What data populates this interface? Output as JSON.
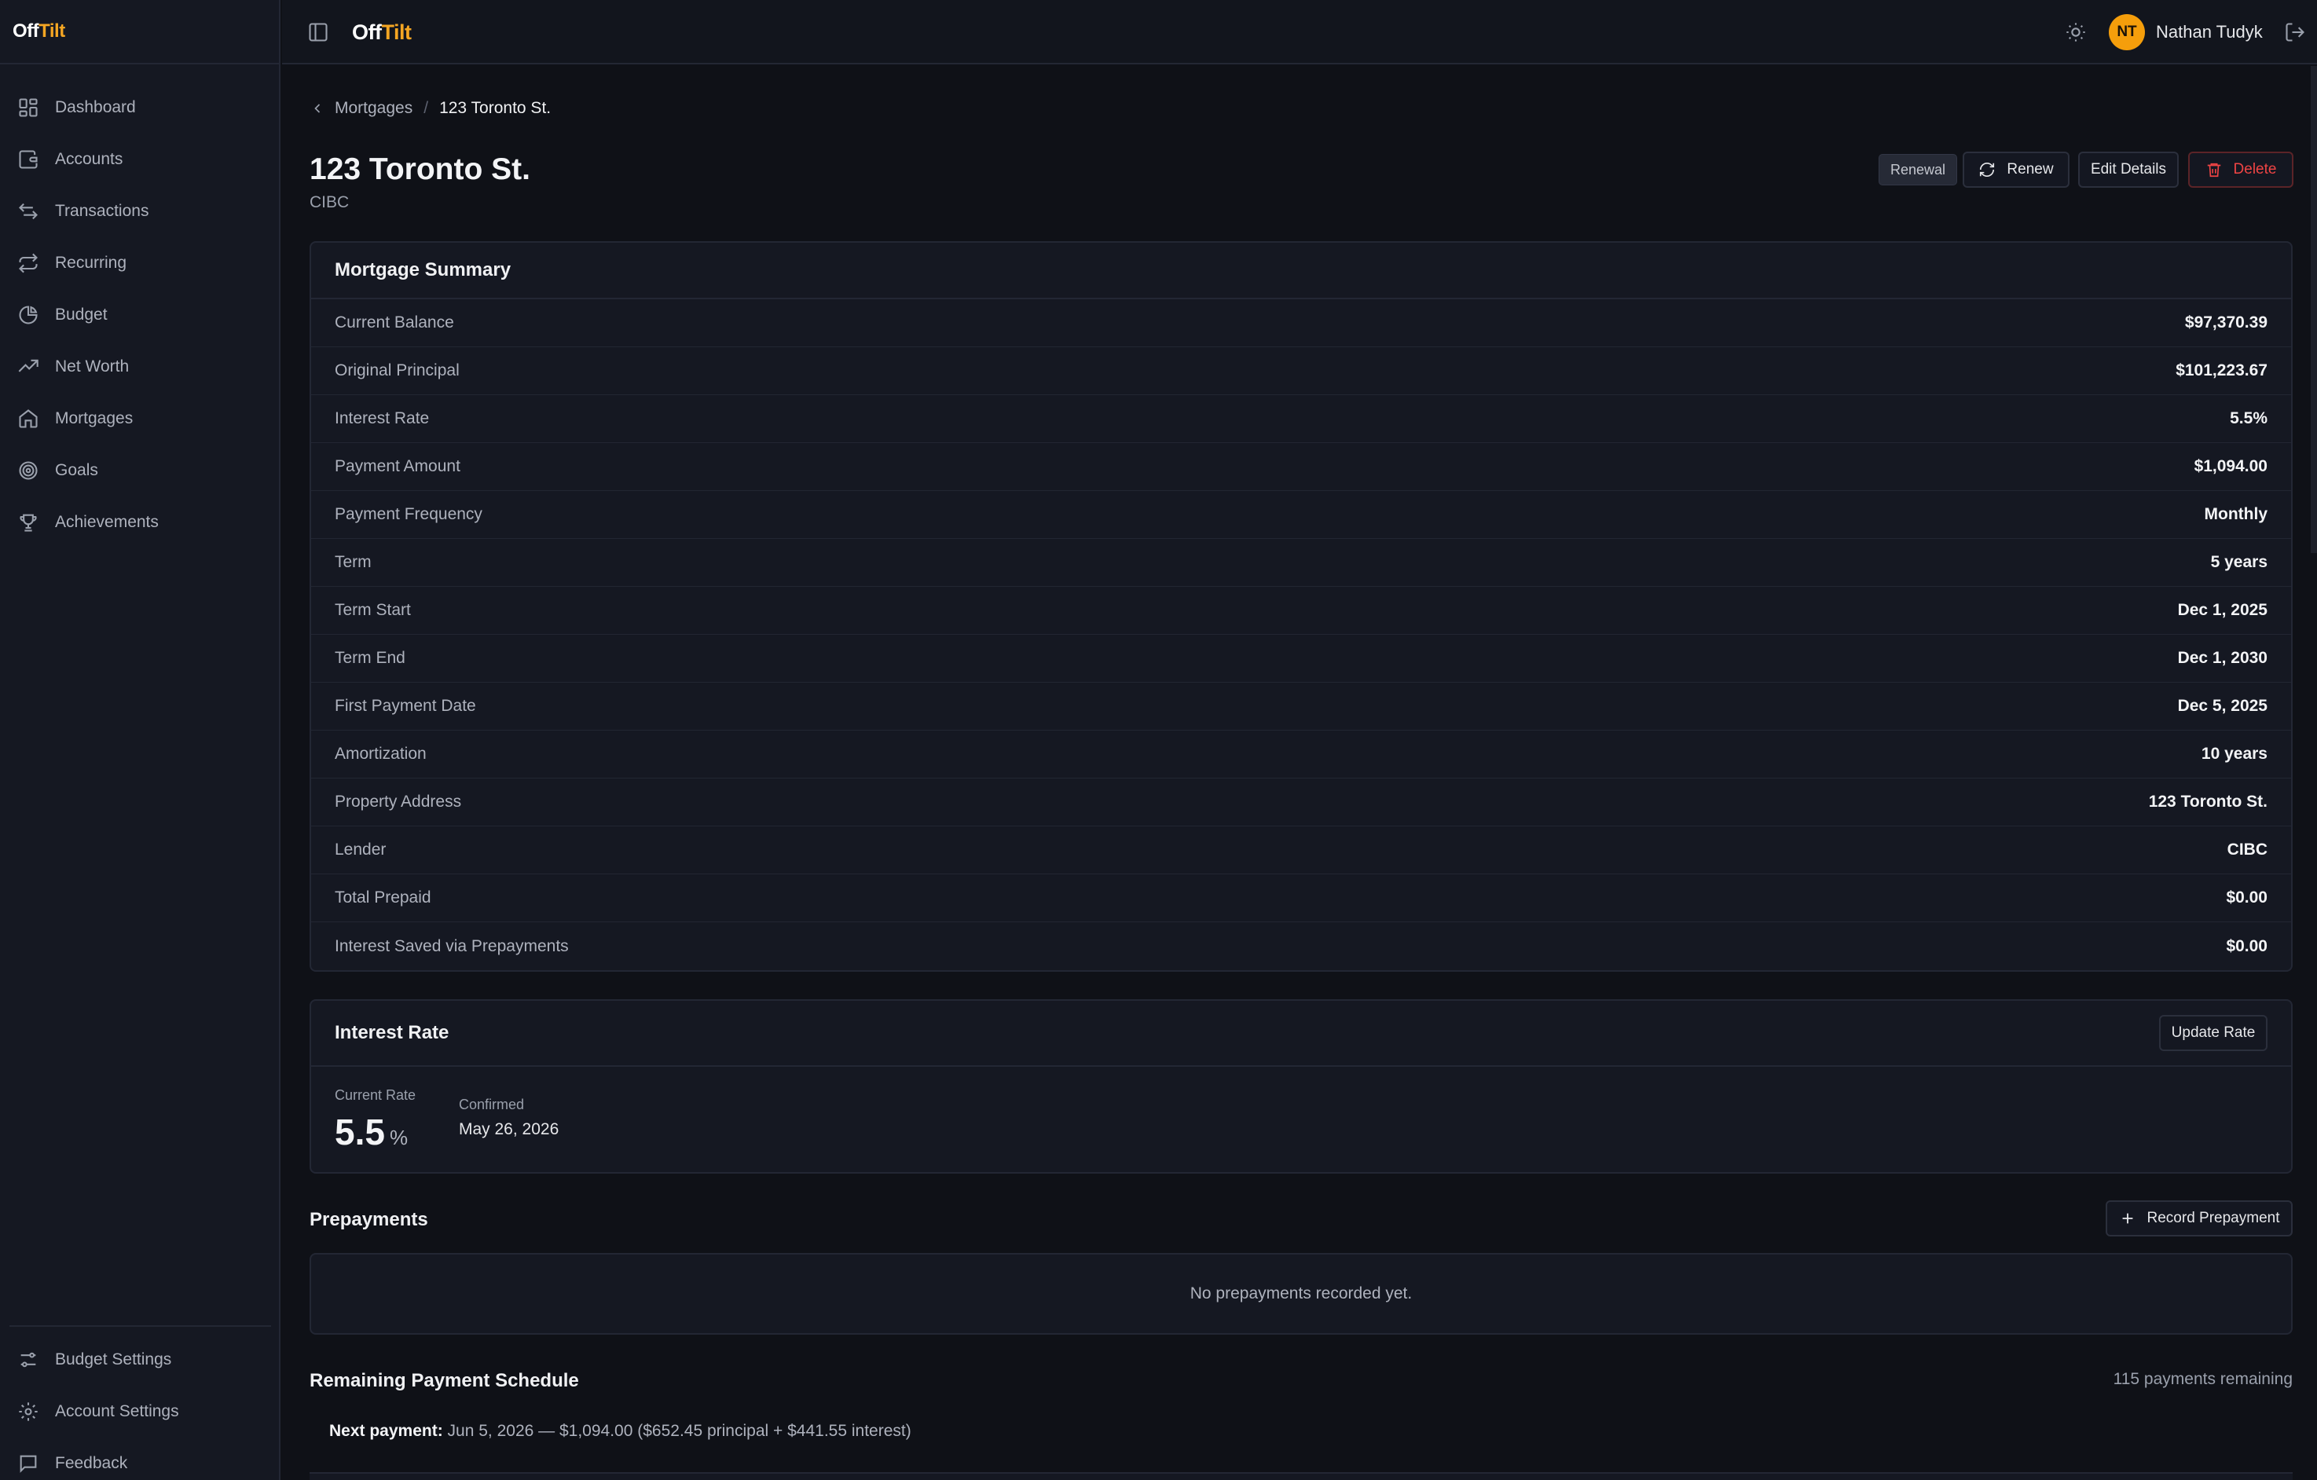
{
  "brand": {
    "logo_part1": "Off",
    "logo_part2": "Tilt"
  },
  "sidebar": {
    "items": [
      {
        "label": "Dashboard",
        "icon": "dashboard-icon"
      },
      {
        "label": "Accounts",
        "icon": "wallet-icon"
      },
      {
        "label": "Transactions",
        "icon": "arrows-left-right-icon"
      },
      {
        "label": "Recurring",
        "icon": "repeat-icon"
      },
      {
        "label": "Budget",
        "icon": "pie-chart-icon"
      },
      {
        "label": "Net Worth",
        "icon": "trending-up-icon"
      },
      {
        "label": "Mortgages",
        "icon": "home-icon"
      },
      {
        "label": "Goals",
        "icon": "target-icon"
      },
      {
        "label": "Achievements",
        "icon": "trophy-icon"
      }
    ],
    "bottom_items": [
      {
        "label": "Budget Settings",
        "icon": "sliders-icon"
      },
      {
        "label": "Account Settings",
        "icon": "gear-icon"
      },
      {
        "label": "Feedback",
        "icon": "message-icon"
      }
    ]
  },
  "header": {
    "user_initials": "NT",
    "user_name": "Nathan Tudyk"
  },
  "breadcrumb": {
    "parent": "Mortgages",
    "separator": "/",
    "current": "123 Toronto St."
  },
  "page": {
    "title": "123 Toronto St.",
    "subtitle": "CIBC",
    "badge": "Renewal",
    "renew_label": "Renew",
    "edit_label": "Edit Details",
    "delete_label": "Delete"
  },
  "summary": {
    "title": "Mortgage Summary",
    "rows": [
      {
        "label": "Current Balance",
        "value": "$97,370.39"
      },
      {
        "label": "Original Principal",
        "value": "$101,223.67"
      },
      {
        "label": "Interest Rate",
        "value": "5.5%"
      },
      {
        "label": "Payment Amount",
        "value": "$1,094.00"
      },
      {
        "label": "Payment Frequency",
        "value": "Monthly"
      },
      {
        "label": "Term",
        "value": "5 years"
      },
      {
        "label": "Term Start",
        "value": "Dec 1, 2025"
      },
      {
        "label": "Term End",
        "value": "Dec 1, 2030"
      },
      {
        "label": "First Payment Date",
        "value": "Dec 5, 2025"
      },
      {
        "label": "Amortization",
        "value": "10 years"
      },
      {
        "label": "Property Address",
        "value": "123 Toronto St."
      },
      {
        "label": "Lender",
        "value": "CIBC"
      },
      {
        "label": "Total Prepaid",
        "value": "$0.00"
      },
      {
        "label": "Interest Saved via Prepayments",
        "value": "$0.00"
      }
    ]
  },
  "interest_rate": {
    "title": "Interest Rate",
    "update_label": "Update Rate",
    "current_label": "Current Rate",
    "current_value": "5.5",
    "unit": "%",
    "confirmed_label": "Confirmed",
    "confirmed_value": "May 26, 2026"
  },
  "prepayments": {
    "title": "Prepayments",
    "record_label": "Record Prepayment",
    "empty_text": "No prepayments recorded yet."
  },
  "schedule": {
    "title": "Remaining Payment Schedule",
    "remaining": "115 payments remaining",
    "next_label": "Next payment:",
    "next_text": "Jun 5, 2026 — $1,094.00 ($652.45 principal + $441.55 interest)"
  },
  "colors": {
    "accent": "#f5a623",
    "danger": "#ef4444",
    "background": "#0f1117",
    "card": "#151822"
  }
}
